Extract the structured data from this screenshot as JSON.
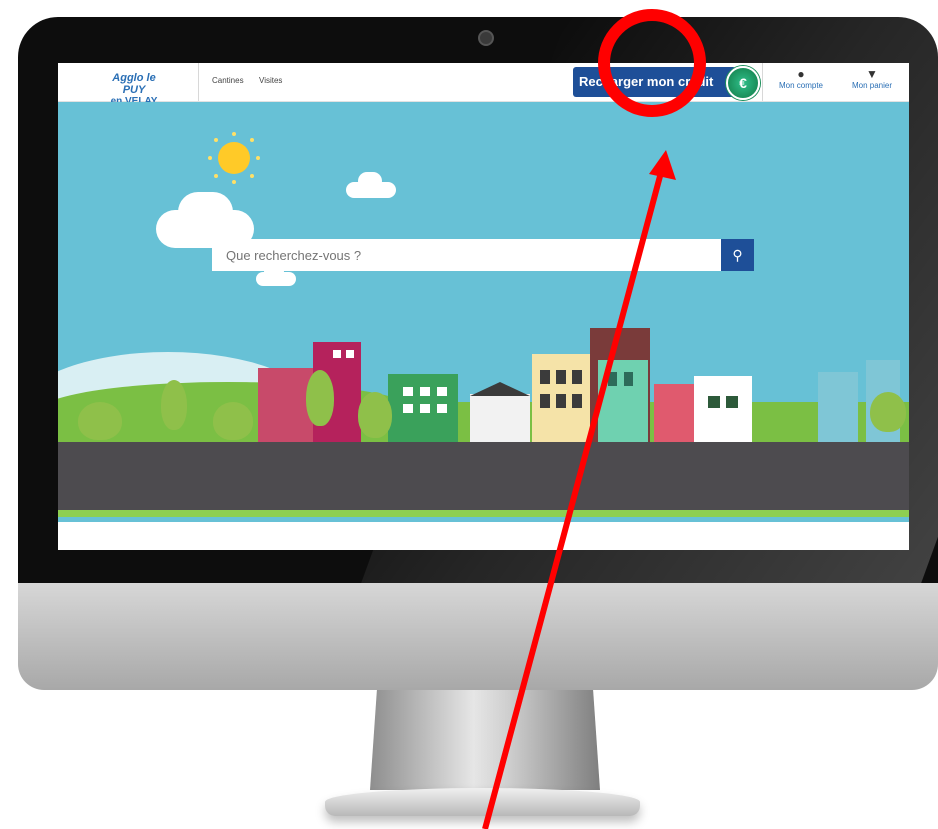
{
  "header": {
    "logo_line1": "Agglo le PUY",
    "logo_line2": "en VELAY",
    "nav": [
      "Cantines",
      "Visites"
    ],
    "credit_button": "Recharger mon crédit",
    "account_label": "Mon compte",
    "cart_label": "Mon panier"
  },
  "search": {
    "placeholder": "Que recherchez-vous ?"
  },
  "icons": {
    "user": "user-icon",
    "cart": "basket-icon",
    "search": "search-icon",
    "euro": "euro-coin-icon"
  },
  "colors": {
    "accent": "#1e4f98",
    "sky": "#67c1d6",
    "annotation": "#ff0000"
  }
}
